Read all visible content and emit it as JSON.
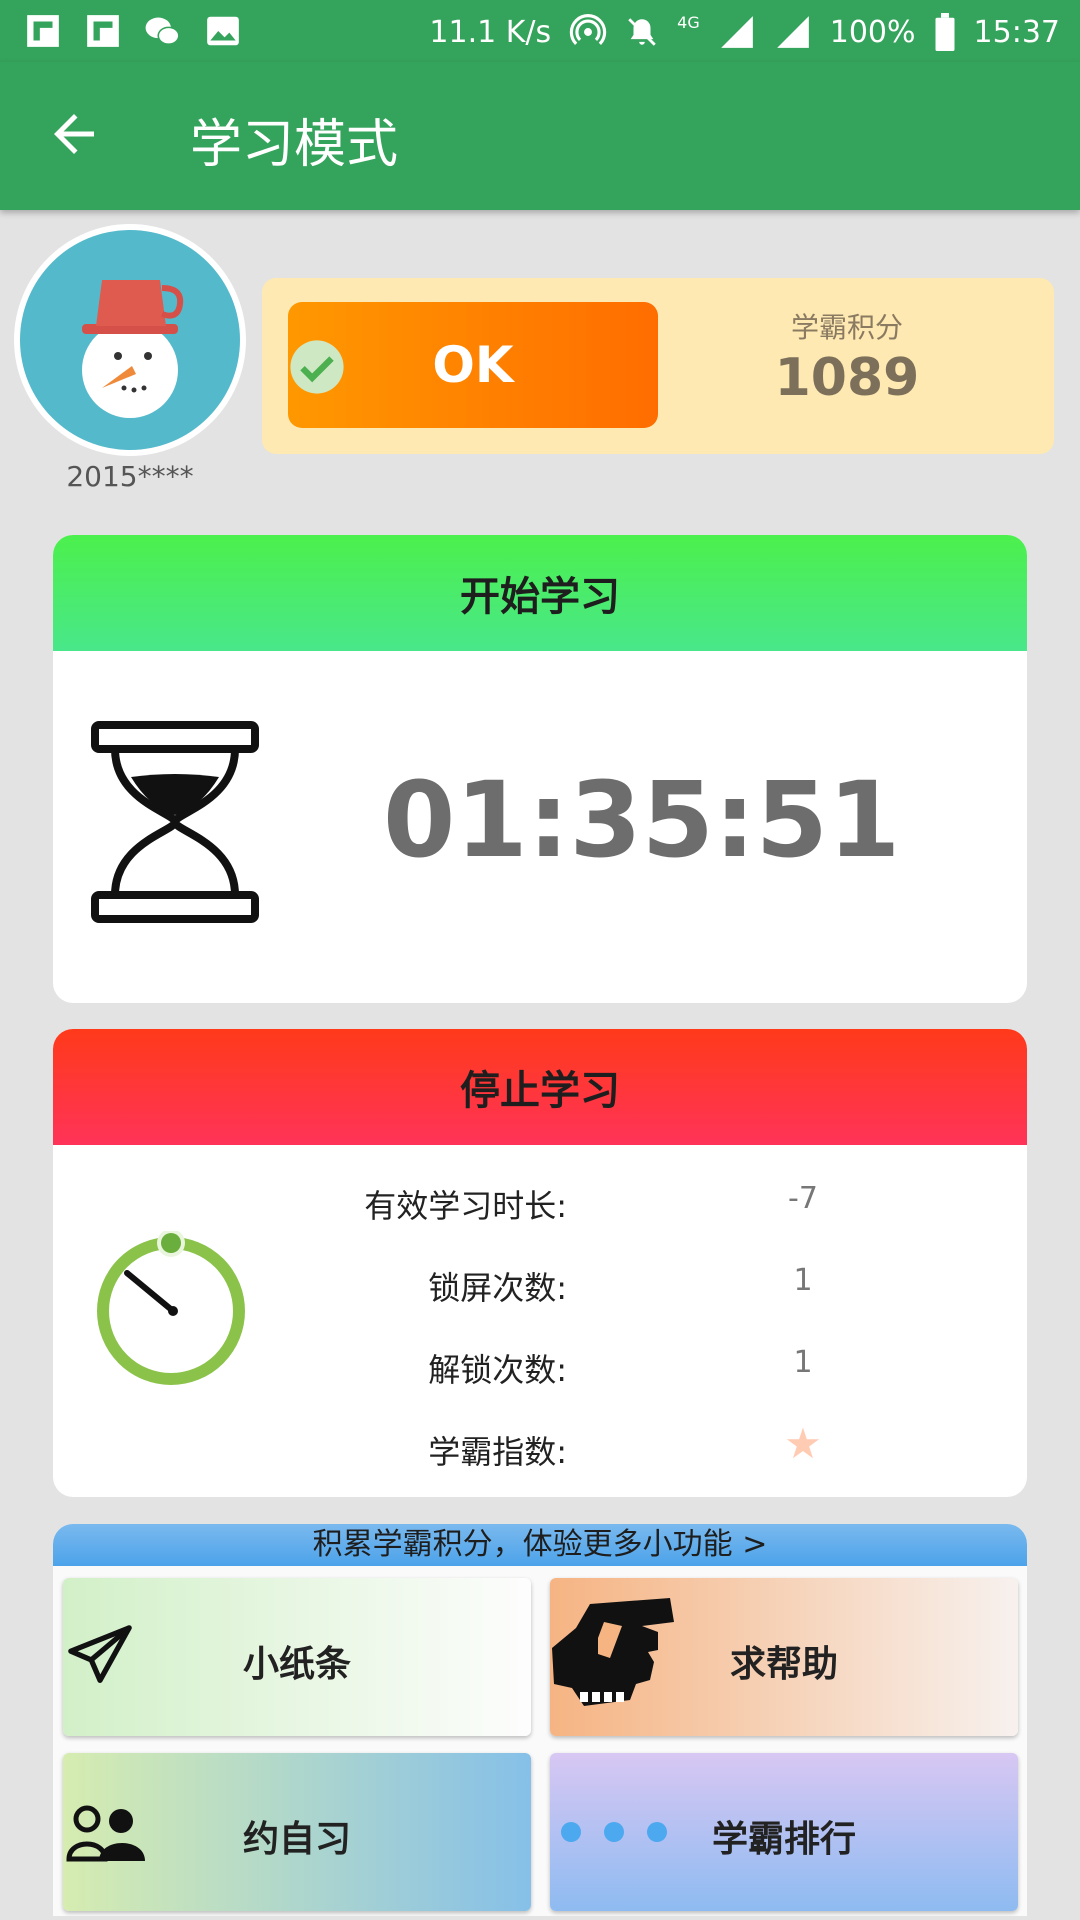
{
  "status_bar": {
    "net_speed": "11.1 K/s",
    "network_type": "4G",
    "battery": "100%",
    "time": "15:37",
    "icons": [
      "flipboard-icon",
      "flipboard-icon",
      "wechat-icon",
      "gallery-icon",
      "hotspot-icon",
      "mute-icon",
      "signal-icon",
      "battery-icon"
    ]
  },
  "app_bar": {
    "title": "学习模式"
  },
  "profile": {
    "user_id": "2015****"
  },
  "score": {
    "ok_label": "OK",
    "label": "学霸积分",
    "value": "1089"
  },
  "start_card": {
    "title": "开始学习",
    "timer": "01:35:51"
  },
  "stop_card": {
    "title": "停止学习",
    "stats": [
      {
        "label": "有效学习时长:",
        "value": "-7"
      },
      {
        "label": "锁屏次数:",
        "value": "1"
      },
      {
        "label": "解锁次数:",
        "value": "1"
      },
      {
        "label": "学霸指数:",
        "value": "★"
      }
    ]
  },
  "features": {
    "banner": "积累学霸积分，体验更多小功能 >",
    "tiles": [
      {
        "label": "小纸条",
        "icon": "paper-plane-icon"
      },
      {
        "label": "求帮助",
        "icon": "help-hand-icon"
      },
      {
        "label": "约自习",
        "icon": "people-icon"
      },
      {
        "label": "学霸排行",
        "icon": "dots-icon"
      }
    ]
  },
  "colors": {
    "primary": "#34a35b",
    "start_header": "#4cf04c",
    "stop_header": "#ff3a1a",
    "ok_button": "#ff8a00",
    "score_panel": "#fde9b1"
  }
}
